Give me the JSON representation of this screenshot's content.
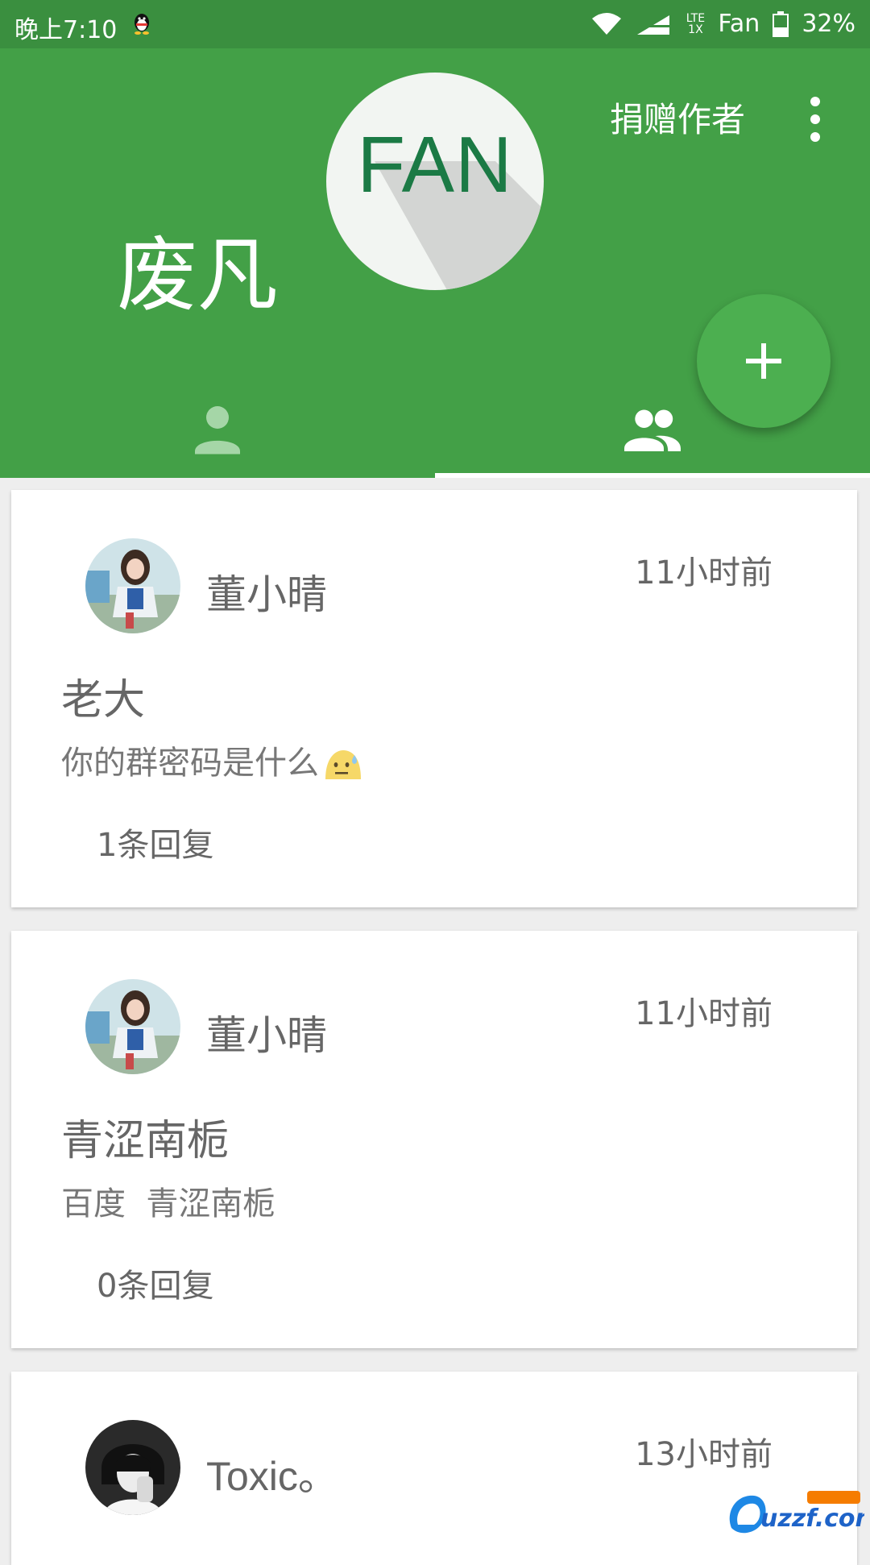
{
  "status_bar": {
    "time": "晚上7:10",
    "network_label": "LTE 1X",
    "carrier": "Fan",
    "battery": "32%"
  },
  "header": {
    "logo_text": "FAN",
    "user_name": "废凡",
    "donate_label": "捐赠作者",
    "bg_color": "#43a047"
  },
  "tabs": [
    {
      "icon": "person-icon",
      "selected": false
    },
    {
      "icon": "group-icon",
      "selected": true
    }
  ],
  "posts": [
    {
      "author": "董小晴",
      "time": "11小时前",
      "title": "老大",
      "body": "你的群密码是什么",
      "body_emoji": "sweat-emoji",
      "replies": "1条回复"
    },
    {
      "author": "董小晴",
      "time": "11小时前",
      "title": "青涩南栀",
      "body": "百度  青涩南栀",
      "replies": "0条回复"
    },
    {
      "author": "Toxic。",
      "time": "13小时前"
    }
  ],
  "watermark_text": "uzzf.com"
}
